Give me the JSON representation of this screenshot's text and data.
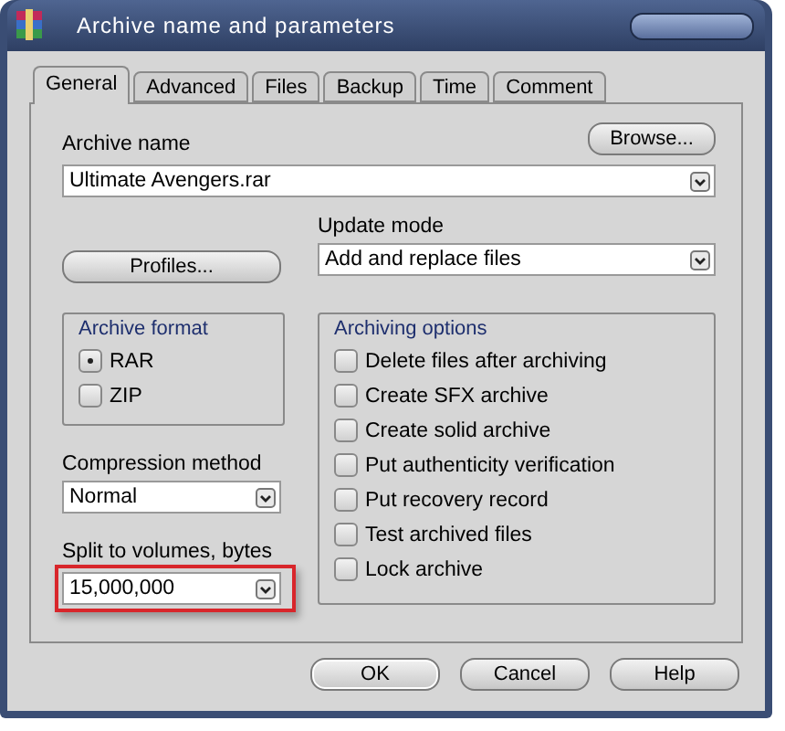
{
  "window": {
    "title": "Archive name and parameters"
  },
  "tabs": [
    {
      "label": "General",
      "selected": true
    },
    {
      "label": "Advanced",
      "selected": false
    },
    {
      "label": "Files",
      "selected": false
    },
    {
      "label": "Backup",
      "selected": false
    },
    {
      "label": "Time",
      "selected": false
    },
    {
      "label": "Comment",
      "selected": false
    }
  ],
  "archive_name": {
    "label": "Archive name",
    "value": "Ultimate Avengers.rar"
  },
  "browse_button": "Browse...",
  "profiles_button": "Profiles...",
  "update_mode": {
    "label": "Update mode",
    "value": "Add and replace files"
  },
  "archive_format": {
    "title": "Archive format",
    "options": [
      {
        "label": "RAR",
        "selected": true
      },
      {
        "label": "ZIP",
        "selected": false
      }
    ]
  },
  "compression_method": {
    "label": "Compression method",
    "value": "Normal"
  },
  "split_volumes": {
    "label": "Split to volumes, bytes",
    "value": "15,000,000",
    "highlighted": true
  },
  "archiving_options": {
    "title": "Archiving options",
    "items": [
      {
        "label": "Delete files after archiving",
        "checked": false
      },
      {
        "label": "Create SFX archive",
        "checked": false
      },
      {
        "label": "Create solid archive",
        "checked": false
      },
      {
        "label": "Put authenticity verification",
        "checked": false
      },
      {
        "label": "Put recovery record",
        "checked": false
      },
      {
        "label": "Test archived files",
        "checked": false
      },
      {
        "label": "Lock archive",
        "checked": false
      }
    ]
  },
  "buttons": [
    "OK",
    "Cancel",
    "Help"
  ]
}
